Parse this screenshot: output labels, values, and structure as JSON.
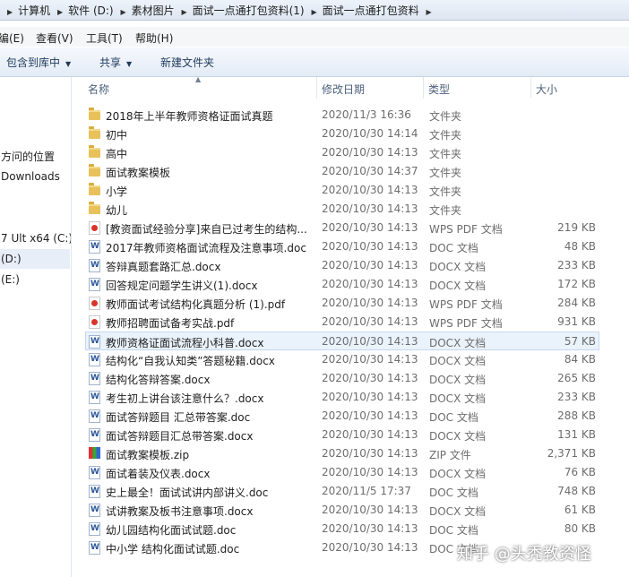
{
  "address_bar": {
    "crumbs": [
      "计算机",
      "软件 (D:)",
      "素材图片",
      "面试一点通打包资料(1)",
      "面试一点通打包资料"
    ]
  },
  "menu": {
    "edit": "编(E)",
    "view": "查看(V)",
    "tools": "工具(T)",
    "help": "帮助(H)"
  },
  "toolbar": {
    "include_library": "包含到库中",
    "share": "共享",
    "new_folder": "新建文件夹"
  },
  "nav": {
    "items": [
      {
        "label": "方问的位置"
      },
      {
        "label": "Downloads"
      },
      {
        "label": "7 Ult x64 (C:)"
      },
      {
        "label": "(D:)"
      },
      {
        "label": "(E:)"
      }
    ]
  },
  "columns": {
    "name": "名称",
    "date": "修改日期",
    "type": "类型",
    "size": "大小"
  },
  "files": [
    {
      "icon": "folder-icon",
      "name": "2018年上半年教师资格证面试真题",
      "date": "2020/11/3 16:36",
      "type": "文件夹",
      "size": ""
    },
    {
      "icon": "folder-icon",
      "name": "初中",
      "date": "2020/10/30 14:14",
      "type": "文件夹",
      "size": ""
    },
    {
      "icon": "folder-icon",
      "name": "高中",
      "date": "2020/10/30 14:13",
      "type": "文件夹",
      "size": ""
    },
    {
      "icon": "folder-icon",
      "name": "面试教案模板",
      "date": "2020/10/30 14:37",
      "type": "文件夹",
      "size": ""
    },
    {
      "icon": "folder-icon",
      "name": "小学",
      "date": "2020/10/30 14:13",
      "type": "文件夹",
      "size": ""
    },
    {
      "icon": "folder-icon",
      "name": "幼儿",
      "date": "2020/10/30 14:13",
      "type": "文件夹",
      "size": ""
    },
    {
      "icon": "pdf-icon",
      "name": "[教资面试经验分享]来自已过考生的结构...",
      "date": "2020/10/30 14:13",
      "type": "WPS PDF 文档",
      "size": "219 KB"
    },
    {
      "icon": "doc-icon",
      "name": "2017年教师资格面试流程及注意事项.doc",
      "date": "2020/10/30 14:13",
      "type": "DOC 文档",
      "size": "48 KB"
    },
    {
      "icon": "doc-icon",
      "name": "答辩真题套路汇总.docx",
      "date": "2020/10/30 14:13",
      "type": "DOCX 文档",
      "size": "233 KB"
    },
    {
      "icon": "doc-icon",
      "name": "回答规定问题学生讲义(1).docx",
      "date": "2020/10/30 14:13",
      "type": "DOCX 文档",
      "size": "172 KB"
    },
    {
      "icon": "pdf-icon",
      "name": "教师面试考试结构化真题分析 (1).pdf",
      "date": "2020/10/30 14:13",
      "type": "WPS PDF 文档",
      "size": "284 KB"
    },
    {
      "icon": "pdf-icon",
      "name": "教师招聘面试备考实战.pdf",
      "date": "2020/10/30 14:13",
      "type": "WPS PDF 文档",
      "size": "931 KB"
    },
    {
      "icon": "doc-icon",
      "name": "教师资格证面试流程小科普.docx",
      "date": "2020/10/30 14:13",
      "type": "DOCX 文档",
      "size": "57 KB"
    },
    {
      "icon": "doc-icon",
      "name": "结构化“自我认知类”答题秘籍.docx",
      "date": "2020/10/30 14:13",
      "type": "DOCX 文档",
      "size": "84 KB"
    },
    {
      "icon": "doc-icon",
      "name": "结构化答辩答案.docx",
      "date": "2020/10/30 14:13",
      "type": "DOCX 文档",
      "size": "265 KB"
    },
    {
      "icon": "doc-icon",
      "name": "考生初上讲台该注意什么？.docx",
      "date": "2020/10/30 14:13",
      "type": "DOCX 文档",
      "size": "233 KB"
    },
    {
      "icon": "doc-icon",
      "name": "面试答辩题目 汇总带答案.doc",
      "date": "2020/10/30 14:13",
      "type": "DOC 文档",
      "size": "288 KB"
    },
    {
      "icon": "doc-icon",
      "name": "面试答辩题目汇总带答案.docx",
      "date": "2020/10/30 14:13",
      "type": "DOCX 文档",
      "size": "131 KB"
    },
    {
      "icon": "zip-icon",
      "name": "面试教案模板.zip",
      "date": "2020/10/30 14:13",
      "type": "ZIP 文件",
      "size": "2,371 KB"
    },
    {
      "icon": "doc-icon",
      "name": "面试着装及仪表.docx",
      "date": "2020/10/30 14:13",
      "type": "DOCX 文档",
      "size": "76 KB"
    },
    {
      "icon": "doc-icon",
      "name": "史上最全！面试试讲内部讲义.doc",
      "date": "2020/11/5 17:37",
      "type": "DOC 文档",
      "size": "748 KB"
    },
    {
      "icon": "doc-icon",
      "name": "试讲教案及板书注意事项.docx",
      "date": "2020/10/30 14:13",
      "type": "DOCX 文档",
      "size": "61 KB"
    },
    {
      "icon": "doc-icon",
      "name": "幼儿园结构化面试试题.doc",
      "date": "2020/10/30 14:13",
      "type": "DOC 文档",
      "size": "80 KB"
    },
    {
      "icon": "doc-icon",
      "name": "中小学 结构化面试试题.doc",
      "date": "2020/10/30 14:13",
      "type": "DOC 文档",
      "size": ""
    }
  ],
  "watermark": "知乎 @头秃教资怪"
}
